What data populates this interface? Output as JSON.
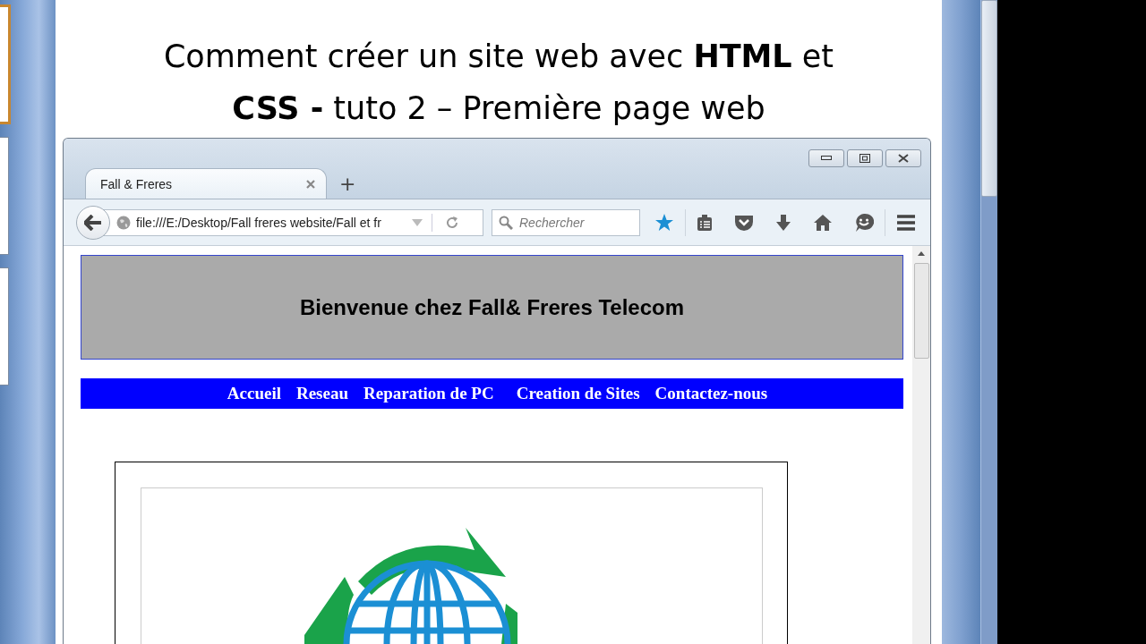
{
  "slide_thumbnails": [
    {
      "selected": true
    },
    {
      "selected": false
    },
    {
      "selected": false
    }
  ],
  "slide": {
    "title_lines": [
      "Comment créer un site web avec **HTML** et",
      "**CSS -** tuto 2 – Première page web"
    ]
  },
  "browser": {
    "tabs": [
      {
        "label": "Fall & Freres",
        "selected": true
      }
    ],
    "new_tab": "+",
    "address": "file:///E:/Desktop/Fall freres website/Fall et fr",
    "search": {
      "placeholder": "Rechercher"
    },
    "bookmarked": true,
    "page": {
      "header": "Bienvenue chez Fall& Freres Telecom",
      "nav": [
        "Accueil",
        "Reseau",
        "Reparation de PC",
        "Creation de Sites",
        "Contactez-nous"
      ]
    }
  }
}
